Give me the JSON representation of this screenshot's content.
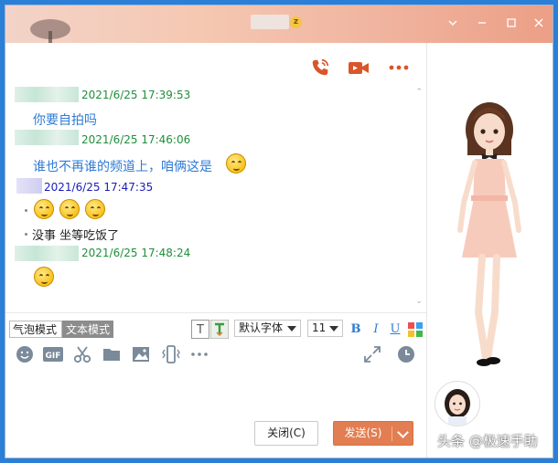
{
  "titlebar": {
    "window_controls": [
      "chevron-down-icon",
      "minimize-icon",
      "maximize-icon",
      "close-icon"
    ]
  },
  "header_actions": [
    "phone-icon",
    "video-call-icon",
    "more-icon"
  ],
  "messages": [
    {
      "time": "2021/6/25 17:39:53",
      "text": "你要自拍吗"
    },
    {
      "time": "2021/6/25 17:46:06",
      "text": "谁也不再谁的频道上，咱俩这是"
    },
    {
      "time": "2021/6/25 17:47:35",
      "text": ""
    },
    {
      "time": "",
      "text": "没事 坐等吃饭了"
    },
    {
      "time": "2021/6/25 17:48:24",
      "text": ""
    }
  ],
  "toolbar": {
    "bubble_mode": "气泡模式",
    "text_mode": "文本模式",
    "font_family": "默认字体",
    "font_size": "11",
    "bold": "B",
    "italic": "I",
    "underline": "U",
    "text_style": "T"
  },
  "actions": {
    "close_label": "关闭(C)",
    "send_label": "发送(S)"
  },
  "watermark": "头条 @极速手助",
  "colors": {
    "accent": "#e27e52",
    "timestamp_green": "#1f8f3b",
    "message_blue": "#2f7bd5"
  }
}
